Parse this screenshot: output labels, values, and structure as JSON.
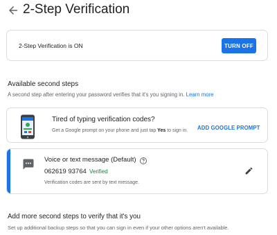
{
  "header": {
    "title": "2-Step Verification",
    "back_icon": "arrow-back-icon"
  },
  "status": {
    "text": "2-Step Verification is ON",
    "button_label": "TURN OFF"
  },
  "available_steps": {
    "title": "Available second steps",
    "description": "A second step after entering your password verifies that it's you signing in.",
    "link": "Learn more"
  },
  "google_prompt": {
    "icon": "phone-icon",
    "title": "Tired of typing verification codes?",
    "description_before": "Get a Google prompt on your phone and just tap",
    "description_bold": "Yes",
    "description_after": "to sign in.",
    "action_label": "ADD GOOGLE PROMPT"
  },
  "voice_text": {
    "icon": "message-icon",
    "title": "Voice or text message (Default)",
    "phone_number": "062619 93764",
    "verified_label": "Verified",
    "description": "Verification codes are sent by text message.",
    "help_icon": "help-icon",
    "edit_icon": "edit-icon"
  },
  "more_steps": {
    "title": "Add more second steps to verify that it's you",
    "description": "Set up additional backup steps so that you can sign in even if your other options aren't available."
  },
  "colors": {
    "accent": "#1a73e8",
    "verified": "#188038",
    "text_primary": "#202124",
    "text_secondary": "#5f6368",
    "border": "#dadce0"
  }
}
